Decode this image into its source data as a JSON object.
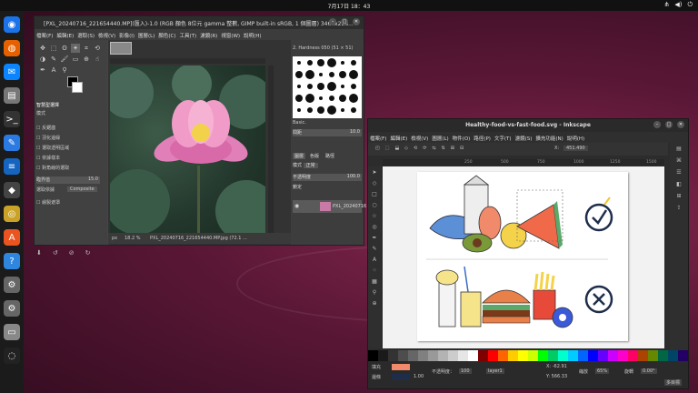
{
  "topbar": {
    "clock": "7月17日 18：43",
    "tray": [
      "network-icon",
      "volume-icon",
      "power-icon"
    ]
  },
  "dock": {
    "apps": [
      {
        "name": "chromium",
        "color": "#1a73e8",
        "glyph": "◉"
      },
      {
        "name": "firefox",
        "color": "#e66000",
        "glyph": "◍"
      },
      {
        "name": "thunderbird",
        "color": "#0a84ff",
        "glyph": "✉"
      },
      {
        "name": "files",
        "color": "#777",
        "glyph": "▤"
      },
      {
        "name": "terminal",
        "color": "#333",
        "glyph": ">_"
      },
      {
        "name": "text-editor",
        "color": "#2a7ae2",
        "glyph": "✎"
      },
      {
        "name": "writer",
        "color": "#1565c0",
        "glyph": "≡"
      },
      {
        "name": "inkscape",
        "color": "#444",
        "glyph": "◆"
      },
      {
        "name": "rhythmbox",
        "color": "#c9a227",
        "glyph": "◎"
      },
      {
        "name": "software",
        "color": "#e95420",
        "glyph": "A"
      },
      {
        "name": "help",
        "color": "#2e86de",
        "glyph": "?"
      },
      {
        "name": "settings",
        "color": "#666",
        "glyph": "⚙"
      },
      {
        "name": "settings2",
        "color": "#666",
        "glyph": "⚙"
      },
      {
        "name": "disk",
        "color": "#888",
        "glyph": "▭"
      },
      {
        "name": "ubuntu",
        "color": "#222",
        "glyph": "◌"
      }
    ]
  },
  "gimp": {
    "title": "[PXL_20240716_221654440.MP](匯入)-1.0 (RGB 顏色 8位元 gamma 整數, GIMP built-in sRGB, 1 個圖層) 3468x226...",
    "menu": [
      "檔案(F)",
      "編輯(E)",
      "選取(S)",
      "檢視(V)",
      "影像(I)",
      "圖層(L)",
      "顏色(C)",
      "工具(T)",
      "濾鏡(R)",
      "視窗(W)",
      "說明(H)"
    ],
    "tool_options_title": "智慧型選擇",
    "mode_label": "模式",
    "opts": [
      "反鋸齒",
      "羽化邊緣",
      "選取透明區域",
      "依據樣本",
      "對角線的選取"
    ],
    "threshold_label": "臨界值",
    "threshold_value": "15.0",
    "select_by_label": "選取依據",
    "select_by_value": "Composite",
    "draw_mask_label": "繪製遮罩",
    "brush_header": "2. Hardness 050 (51 × 51)",
    "brush_preset": "Basic.",
    "spacing_label": "間距",
    "spacing_value": "10.0",
    "layers_tabs": [
      "圖層",
      "色版",
      "路徑"
    ],
    "mode_value": "正常",
    "opacity_label": "不透明度",
    "opacity_value": "100.0",
    "lock_label": "鎖定",
    "layer_name": "PXL_20240716",
    "status_unit": "px",
    "status_zoom": "18.2 %",
    "status_file": "PXL_20240716_221654440.MP.jpg (72.1 ..."
  },
  "inkscape": {
    "title": "Healthy-food-vs-fast-food.svg - Inkscape",
    "menu": [
      "檔案(F)",
      "編輯(E)",
      "檢視(V)",
      "圖層(L)",
      "物件(O)",
      "路徑(P)",
      "文字(T)",
      "濾鏡(S)",
      "擴充功能(N)",
      "說明(H)"
    ],
    "x_label": "X:",
    "x_value": "451.490",
    "ruler": [
      "250",
      "500",
      "750",
      "1000",
      "1250",
      "1500"
    ],
    "fill_label": "填充",
    "stroke_label": "邊條",
    "stroke_value": "1.00",
    "opacity_label": "不透明度：",
    "opacity_value": "100",
    "layer_value": "layer1",
    "coord_x": "-62.91",
    "coord_y": "566.33",
    "zoom_label": "縮放",
    "zoom_value": "65%",
    "rotate_label": "旋轉",
    "rotate_value": "0.00°",
    "status_tag": "多目標",
    "palette": [
      "#000000",
      "#1a1a1a",
      "#333333",
      "#4d4d4d",
      "#666666",
      "#808080",
      "#999999",
      "#b3b3b3",
      "#cccccc",
      "#e6e6e6",
      "#ffffff",
      "#800000",
      "#ff0000",
      "#ff6600",
      "#ffcc00",
      "#ffff00",
      "#ccff00",
      "#00ff00",
      "#00cc66",
      "#00ffcc",
      "#00ccff",
      "#0066ff",
      "#0000ff",
      "#6600ff",
      "#cc00ff",
      "#ff00cc",
      "#ff0066",
      "#aa4400",
      "#668800",
      "#006644",
      "#004466",
      "#220066"
    ]
  }
}
